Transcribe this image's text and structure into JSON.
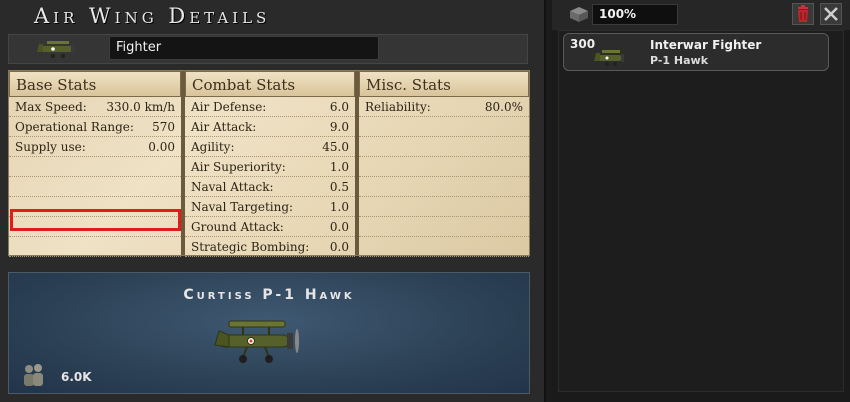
{
  "window": {
    "title": "Air Wing Details"
  },
  "name_field": {
    "value": "Fighter"
  },
  "stats": {
    "base": {
      "header": "Base Stats",
      "rows": [
        {
          "label": "Max Speed:",
          "value": "330.0 km/h"
        },
        {
          "label": "Operational Range:",
          "value": "570"
        },
        {
          "label": "Supply use:",
          "value": "0.00"
        }
      ]
    },
    "combat": {
      "header": "Combat Stats",
      "rows": [
        {
          "label": "Air Defense:",
          "value": "6.0"
        },
        {
          "label": "Air Attack:",
          "value": "9.0"
        },
        {
          "label": "Agility:",
          "value": "45.0"
        },
        {
          "label": "Air Superiority:",
          "value": "1.0"
        },
        {
          "label": "Naval Attack:",
          "value": "0.5"
        },
        {
          "label": "Naval Targeting:",
          "value": "1.0"
        },
        {
          "label": "Ground Attack:",
          "value": "0.0"
        },
        {
          "label": "Strategic Bombing:",
          "value": "0.0"
        }
      ]
    },
    "misc": {
      "header": "Misc. Stats",
      "rows": [
        {
          "label": "Reliability:",
          "value": "80.0%"
        }
      ]
    }
  },
  "portrait": {
    "plane_name": "Curtiss P-1 Hawk",
    "manpower": "6.0K"
  },
  "right_panel": {
    "percent": "100%",
    "wing": {
      "count": "300",
      "type": "Interwar Fighter",
      "model": "P-1 Hawk"
    }
  },
  "colors": {
    "highlight": "#e21b1b",
    "paper": "#e8d9b8",
    "plane_body": "#55602a"
  },
  "icons": [
    "plane-icon",
    "crew-icon",
    "crate-icon",
    "trash-icon",
    "close-icon"
  ]
}
